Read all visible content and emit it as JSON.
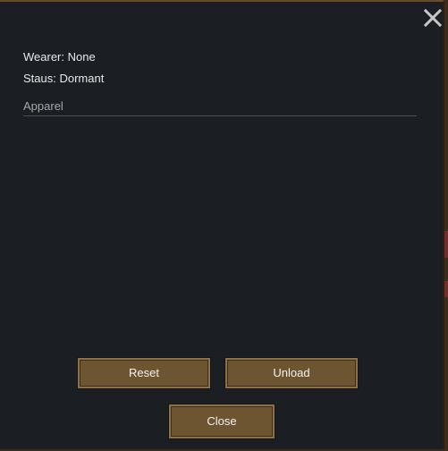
{
  "dialog": {
    "wearer_text": "Wearer: None",
    "status_text": "Staus: Dormant",
    "section_header": "Apparel",
    "close_icon": "close-x-icon"
  },
  "buttons": {
    "reset_label": "Reset",
    "unload_label": "Unload",
    "close_label": "Close"
  },
  "colors": {
    "dialog_background": "#1b1e23",
    "button_fill": "#6e5532",
    "button_border": "#8d7146",
    "header_border": "#6b4a2a"
  }
}
